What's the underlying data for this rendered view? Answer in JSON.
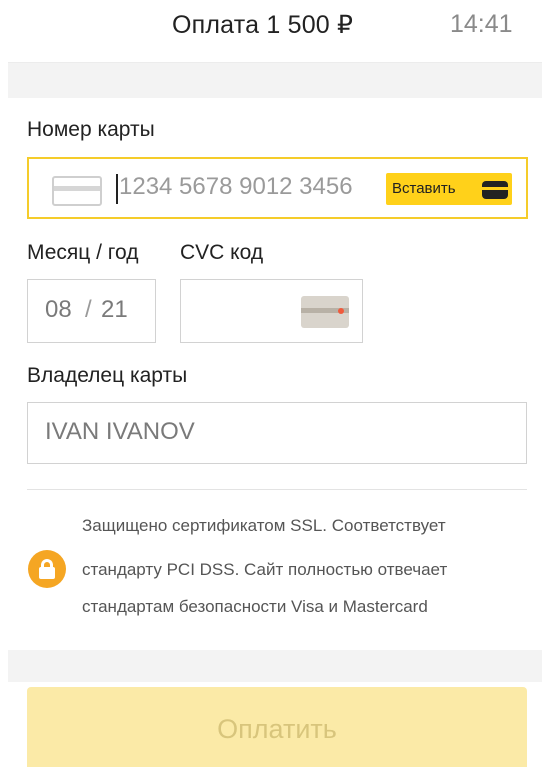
{
  "header": {
    "title": "Оплата 1 500 ₽",
    "time": "14:41"
  },
  "form": {
    "card_number": {
      "label": "Номер карты",
      "placeholder": "1234 5678 9012 3456",
      "paste_label": "Вставить",
      "card_icon": "card-icon",
      "paste_icon": "card-icon"
    },
    "expiry": {
      "label": "Месяц / год",
      "month": "08",
      "separator": "/",
      "year": "21"
    },
    "cvc": {
      "label": "CVC код",
      "icon": "card-back-icon"
    },
    "owner": {
      "label": "Владелец карты",
      "value": "IVAN IVANOV"
    }
  },
  "security": {
    "icon": "lock-icon",
    "lines": [
      "Защищено сертификатом SSL. Соответствует",
      "стандарту PCI DSS. Сайт полностью отвечает",
      "стандартам безопасности Visa и Mastercard"
    ]
  },
  "pay_button": {
    "label": "Оплатить"
  },
  "colors": {
    "accent": "#ffd11a",
    "focus_border": "#f5cc2a",
    "lock": "#f5a623",
    "pay_disabled": "#fbeaa7"
  }
}
